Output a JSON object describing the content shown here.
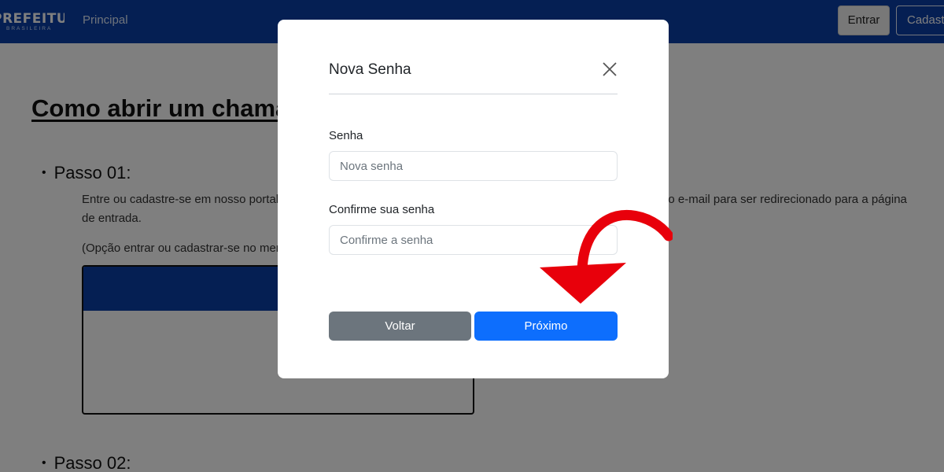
{
  "navbar": {
    "logo_main": "PREFEITURA",
    "logo_sub": "BRASILEIRA",
    "nav_link": "Principal",
    "entrar_label": "Entrar",
    "cadastrar_label": "Cadastrar"
  },
  "page": {
    "title": "Como abrir um chamado",
    "step1_title": "Passo 01:",
    "step1_text": "Entre ou cadastre-se em nosso portal. Caso não receba o e-mail de verificação, tente se cadastrar com o mesmo e-mail para ser redirecionado para a página de entrada.",
    "step1_note": "(Opção entrar ou cadastrar-se no menu superior)",
    "step2_title": "Passo 02:"
  },
  "modal": {
    "title": "Nova Senha",
    "password_label": "Senha",
    "password_placeholder": "Nova senha",
    "confirm_label": "Confirme sua senha",
    "confirm_placeholder": "Confirme a senha",
    "back_label": "Voltar",
    "next_label": "Próximo"
  },
  "icons": {
    "close": "close-icon",
    "annotation": "red-curved-arrow-icon"
  },
  "colors": {
    "navbar": "#0b3fa6",
    "primary_button": "#0d6efd",
    "secondary_button": "#6c757d",
    "arrow": "#e8000b"
  }
}
